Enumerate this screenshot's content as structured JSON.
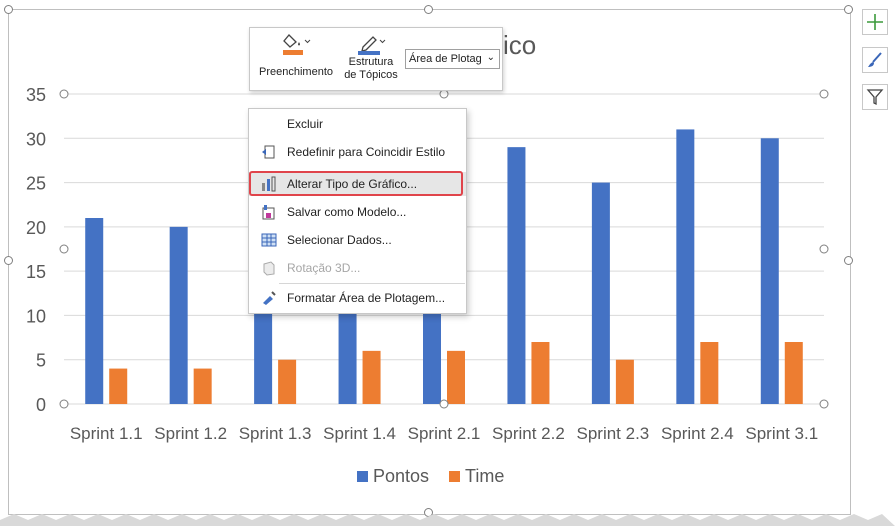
{
  "chart_data": {
    "type": "bar",
    "title": "ico",
    "categories": [
      "Sprint 1.1",
      "Sprint 1.2",
      "Sprint 1.3",
      "Sprint 1.4",
      "Sprint 2.1",
      "Sprint 2.2",
      "Sprint 2.3",
      "Sprint 2.4",
      "Sprint 3.1"
    ],
    "series": [
      {
        "name": "Pontos",
        "values": [
          21,
          20,
          23,
          22,
          21,
          29,
          25,
          31,
          30
        ],
        "color": "#4472c4"
      },
      {
        "name": "Time",
        "values": [
          4,
          4,
          5,
          6,
          6,
          7,
          5,
          7,
          7
        ],
        "color": "#ed7d31"
      }
    ],
    "ylim": [
      0,
      35
    ],
    "yticks": [
      "0",
      "5",
      "10",
      "15",
      "20",
      "25",
      "30",
      "35"
    ],
    "grid": true,
    "legend_position": "bottom"
  },
  "toolbar": {
    "fill_label": "Preenchimento",
    "outline_label_line1": "Estrutura",
    "outline_label_line2": "de Tópicos",
    "area_dropdown_value": "Área de Plotag"
  },
  "context_menu": {
    "items": [
      {
        "label": "Excluir",
        "icon": "none",
        "disabled": false
      },
      {
        "label": "Redefinir para Coincidir Estilo",
        "icon": "reset-style-icon",
        "disabled": false
      },
      {
        "label": "Alterar Tipo de Gráfico...",
        "icon": "change-chart-type-icon",
        "disabled": false
      },
      {
        "label": "Salvar como Modelo...",
        "icon": "save-template-icon",
        "disabled": false
      },
      {
        "label": "Selecionar Dados...",
        "icon": "select-data-icon",
        "disabled": false
      },
      {
        "label": "Rotação 3D...",
        "icon": "rotation-3d-icon",
        "disabled": true
      },
      {
        "label": "Formatar Área de Plotagem...",
        "icon": "format-plot-area-icon",
        "disabled": false
      }
    ]
  },
  "side_buttons": [
    "chart-elements-icon",
    "chart-styles-icon",
    "chart-filters-icon"
  ]
}
